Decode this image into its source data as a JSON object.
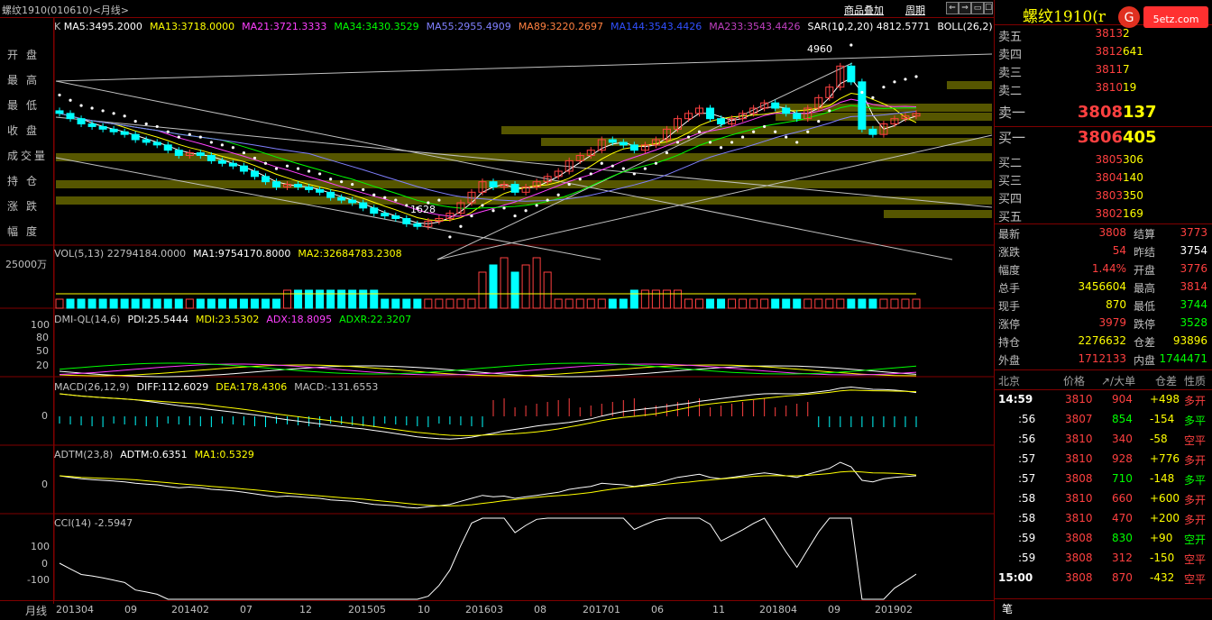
{
  "window": {
    "title": "螺纹1910(010610)<月线>",
    "links": [
      "商品叠加",
      "周期"
    ],
    "buttons": [
      "⇐",
      "⇒",
      "▭",
      "☐",
      "×"
    ]
  },
  "left_menu": [
    "开盘",
    "最高",
    "最低",
    "收盘",
    "成交量",
    "持仓",
    "涨跌",
    "幅度"
  ],
  "main_panel": {
    "k_label": "K",
    "ma_legend": [
      {
        "text": "MA5:3495.2000",
        "color": "#ffffff"
      },
      {
        "text": "MA13:3718.0000",
        "color": "#ffff00"
      },
      {
        "text": "MA21:3721.3333",
        "color": "#ff40ff"
      },
      {
        "text": "MA34:3430.3529",
        "color": "#00ff00"
      },
      {
        "text": "MA55:2955.4909",
        "color": "#8080ff"
      },
      {
        "text": "MA89:3220.2697",
        "color": "#ff8040"
      },
      {
        "text": "MA144:3543.4426",
        "color": "#3050ff"
      },
      {
        "text": "MA233:3543.4426",
        "color": "#c040c0"
      },
      {
        "text": "SAR(10,2,20)  4812.5771",
        "color": "#ffffff"
      },
      {
        "text": "BOLL(26,2)",
        "color": "#ffffff"
      }
    ],
    "high_label": "4960",
    "low_label": "1628"
  },
  "vol_panel": {
    "legend": [
      {
        "text": "VOL(5,13)  22794184.0000",
        "color": "#c0c0c0"
      },
      {
        "text": "MA1:9754170.8000",
        "color": "#ffffff"
      },
      {
        "text": "MA2:32684783.2308",
        "color": "#ffff00"
      }
    ],
    "axis_label": "25000万"
  },
  "dmi_panel": {
    "legend": [
      {
        "text": "DMI-QL(14,6)",
        "color": "#c0c0c0"
      },
      {
        "text": "PDI:25.5444",
        "color": "#ffffff"
      },
      {
        "text": "MDI:23.5302",
        "color": "#ffff00"
      },
      {
        "text": "ADX:18.8095",
        "color": "#ff40ff"
      },
      {
        "text": "ADXR:22.3207",
        "color": "#00ff00"
      }
    ],
    "axis": [
      "100",
      "80",
      "50",
      "20"
    ]
  },
  "macd_panel": {
    "legend": [
      {
        "text": "MACD(26,12,9)",
        "color": "#c0c0c0"
      },
      {
        "text": "DIFF:112.6029",
        "color": "#ffffff"
      },
      {
        "text": "DEA:178.4306",
        "color": "#ffff00"
      },
      {
        "text": "MACD:-131.6553",
        "color": "#c0c0c0"
      }
    ],
    "axis": [
      "0"
    ]
  },
  "adtm_panel": {
    "legend": [
      {
        "text": "ADTM(23,8)",
        "color": "#c0c0c0"
      },
      {
        "text": "ADTM:0.6351",
        "color": "#ffffff"
      },
      {
        "text": "MA1:0.5329",
        "color": "#ffff00"
      }
    ],
    "axis": [
      "0"
    ]
  },
  "cci_panel": {
    "legend": [
      {
        "text": "CCI(14)  -2.5947",
        "color": "#c0c0c0"
      }
    ],
    "axis": [
      "100",
      "0",
      "-100"
    ]
  },
  "x_axis": {
    "period_label": "月线",
    "ticks": [
      "201304",
      "09",
      "201402",
      "07",
      "12",
      "201505",
      "10",
      "201603",
      "08",
      "201701",
      "06",
      "11",
      "201804",
      "09",
      "201902"
    ]
  },
  "quote": {
    "name": "螺纹1910(r",
    "asks": [
      {
        "label": "卖五",
        "price": "3813",
        "vol": "2"
      },
      {
        "label": "卖四",
        "price": "3812",
        "vol": "641"
      },
      {
        "label": "卖三",
        "price": "3811",
        "vol": "7"
      },
      {
        "label": "卖二",
        "price": "3810",
        "vol": "19"
      },
      {
        "label": "卖一",
        "price": "3808",
        "vol": "137"
      }
    ],
    "bids": [
      {
        "label": "买一",
        "price": "3806",
        "vol": "405"
      },
      {
        "label": "买二",
        "price": "3805",
        "vol": "306"
      },
      {
        "label": "买三",
        "price": "3804",
        "vol": "140"
      },
      {
        "label": "买四",
        "price": "3803",
        "vol": "350"
      },
      {
        "label": "买五",
        "price": "3802",
        "vol": "169"
      }
    ],
    "stats": [
      {
        "l1": "最新",
        "v1": "3808",
        "c1": "#ff4040",
        "l2": "结算",
        "v2": "3773",
        "c2": "#ff4040"
      },
      {
        "l1": "涨跌",
        "v1": "54",
        "c1": "#ff4040",
        "l2": "昨结",
        "v2": "3754",
        "c2": "#ffffff"
      },
      {
        "l1": "幅度",
        "v1": "1.44%",
        "c1": "#ff4040",
        "l2": "开盘",
        "v2": "3776",
        "c2": "#ff4040"
      },
      {
        "l1": "总手",
        "v1": "3456604",
        "c1": "#ffff00",
        "l2": "最高",
        "v2": "3814",
        "c2": "#ff4040"
      },
      {
        "l1": "现手",
        "v1": "870",
        "c1": "#ffff00",
        "l2": "最低",
        "v2": "3744",
        "c2": "#00ff00"
      },
      {
        "l1": "涨停",
        "v1": "3979",
        "c1": "#ff4040",
        "l2": "跌停",
        "v2": "3528",
        "c2": "#00ff00"
      },
      {
        "l1": "持仓",
        "v1": "2276632",
        "c1": "#ffff00",
        "l2": "仓差",
        "v2": "93896",
        "c2": "#ffff00"
      },
      {
        "l1": "外盘",
        "v1": "1712133",
        "c1": "#ff4040",
        "l2": "内盘",
        "v2": "1744471",
        "c2": "#00ff00"
      }
    ],
    "ticks_header": [
      "北京",
      "价格",
      "↗/大单",
      "仓差",
      "性质"
    ],
    "ticks": [
      {
        "time": "14:59",
        "price": "3810",
        "vol": "904",
        "vc": "#ff4040",
        "diff": "+498",
        "dc": "#ffff00",
        "kind": "多开",
        "kc": "#ff4040"
      },
      {
        "time": ":56",
        "price": "3807",
        "vol": "854",
        "vc": "#00ff00",
        "diff": "-154",
        "dc": "#ffff00",
        "kind": "多平",
        "kc": "#00ff00"
      },
      {
        "time": ":56",
        "price": "3810",
        "vol": "340",
        "vc": "#ff4040",
        "diff": "-58",
        "dc": "#ffff00",
        "kind": "空平",
        "kc": "#ff4040"
      },
      {
        "time": ":57",
        "price": "3810",
        "vol": "928",
        "vc": "#ff4040",
        "diff": "+776",
        "dc": "#ffff00",
        "kind": "多开",
        "kc": "#ff4040"
      },
      {
        "time": ":57",
        "price": "3808",
        "vol": "710",
        "vc": "#00ff00",
        "diff": "-148",
        "dc": "#ffff00",
        "kind": "多平",
        "kc": "#00ff00"
      },
      {
        "time": ":58",
        "price": "3810",
        "vol": "660",
        "vc": "#ff4040",
        "diff": "+600",
        "dc": "#ffff00",
        "kind": "多开",
        "kc": "#ff4040"
      },
      {
        "time": ":58",
        "price": "3810",
        "vol": "470",
        "vc": "#ff4040",
        "diff": "+200",
        "dc": "#ffff00",
        "kind": "多开",
        "kc": "#ff4040"
      },
      {
        "time": ":59",
        "price": "3808",
        "vol": "830",
        "vc": "#00ff00",
        "diff": "+90",
        "dc": "#ffff00",
        "kind": "空开",
        "kc": "#00ff00"
      },
      {
        "time": ":59",
        "price": "3808",
        "vol": "312",
        "vc": "#ff4040",
        "diff": "-150",
        "dc": "#ffff00",
        "kind": "空平",
        "kc": "#ff4040"
      },
      {
        "time": "15:00",
        "price": "3808",
        "vol": "870",
        "vc": "#ff4040",
        "diff": "-432",
        "dc": "#ffff00",
        "kind": "空平",
        "kc": "#ff4040"
      }
    ],
    "footer": "笔",
    "watermark": "5etz.com"
  }
}
